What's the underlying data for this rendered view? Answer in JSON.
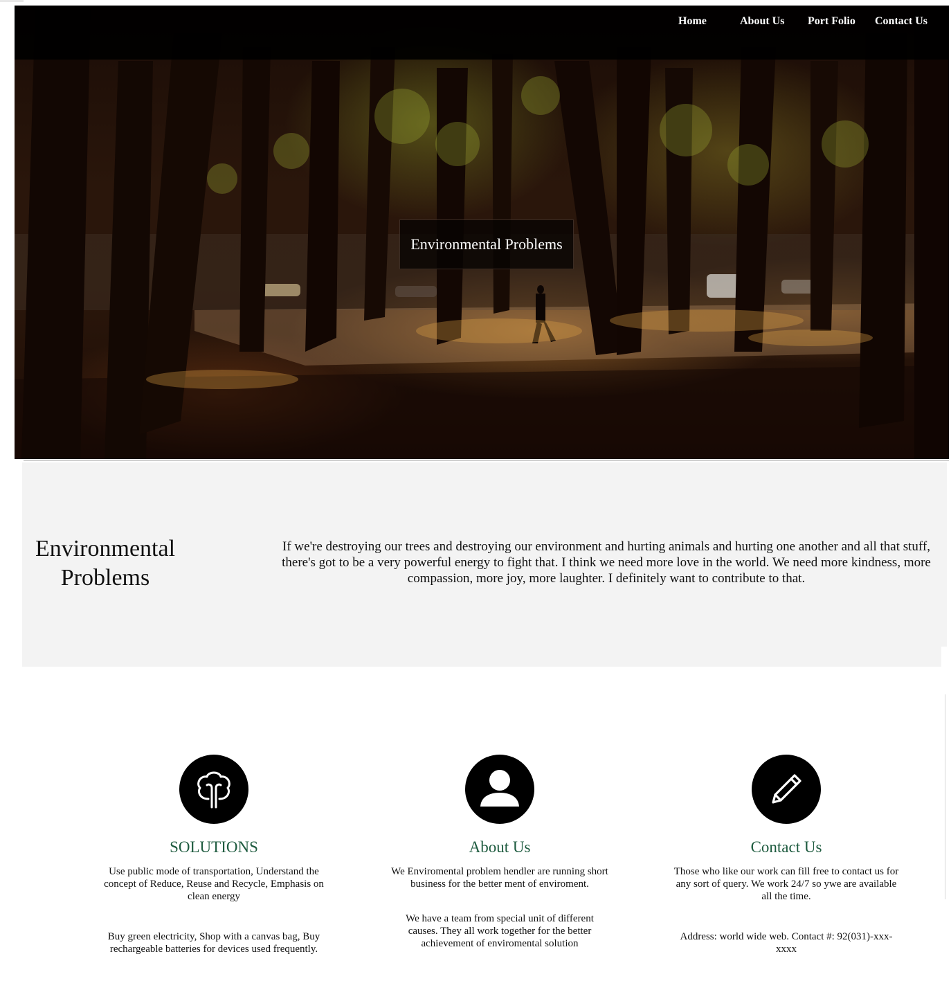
{
  "nav": {
    "items": [
      "Home",
      "About Us",
      "Port Folio",
      "Contact Us"
    ]
  },
  "hero": {
    "title": "Environmental Problems"
  },
  "intro": {
    "title": "Environmental Problems",
    "text": "If we're destroying our trees and destroying our environment and hurting animals and hurting one another and all that stuff, there's got to be a very powerful energy to fight that. I think we need more love in the world. We need more kindness, more compassion, more joy, more laughter. I definitely want to contribute to that."
  },
  "features": [
    {
      "icon": "tree-icon",
      "title": "SOLUTIONS",
      "paragraphs": [
        "Use public mode of transportation, Understand the concept of Reduce, Reuse and Recycle, Emphasis on clean energy",
        "Buy green electricity, Shop with a canvas bag, Buy rechargeable batteries for devices used frequently."
      ]
    },
    {
      "icon": "user-icon",
      "title": "About Us",
      "paragraphs": [
        "We Enviromental problem hendler are running short business for the better ment of enviroment.",
        "We have a team from special unit of different causes. They all work together for the better achievement of enviromental solution"
      ]
    },
    {
      "icon": "pencil-icon",
      "title": "Contact Us",
      "paragraphs": [
        "Those who like our work can fill free to contact us for any sort of query. We work 24/7 so ywe are available all the time.",
        "Address: world wide web. Contact #: 92(031)-xxx-xxxx"
      ]
    }
  ],
  "colors": {
    "nav_bg": "#000000",
    "feature_title": "#1e5b3f",
    "intro_bg": "#f3f3f3"
  }
}
